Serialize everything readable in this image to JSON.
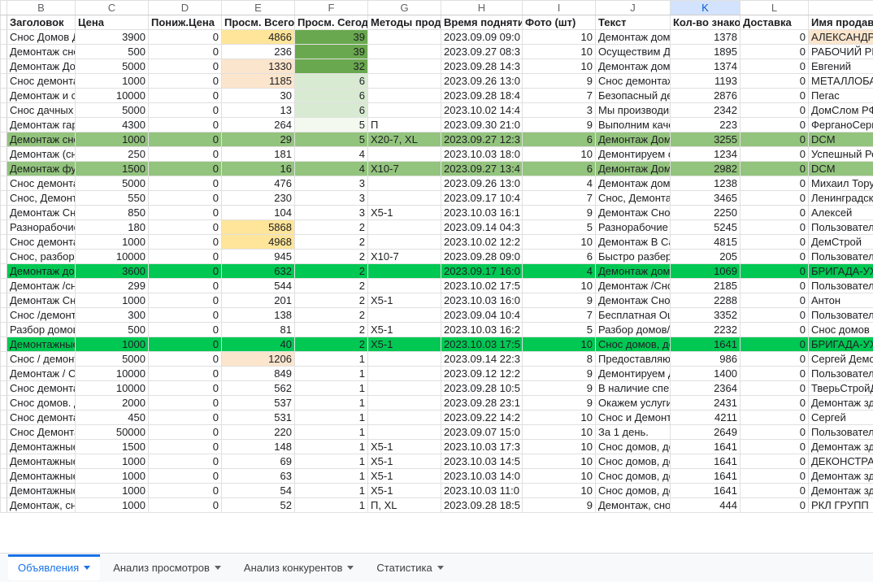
{
  "columns": [
    "",
    "B",
    "C",
    "D",
    "E",
    "F",
    "G",
    "H",
    "I",
    "J",
    "K",
    "L",
    ""
  ],
  "selectedCol": 10,
  "headers": {
    "B": "Заголовок",
    "C": "Цена",
    "D": "Пониж.Цена",
    "E": "Просм. Всего",
    "F": "Просм. Сегодня",
    "G": "Методы продв",
    "H": "Время поднятия",
    "I": "Фото (шт)",
    "J": "Текст",
    "K": "Кол-во знаков",
    "L": "Доставка",
    "M": "Имя продав"
  },
  "rows": [
    {
      "B": "Снос Домов Де",
      "C": "3900",
      "D": "0",
      "E": "4866",
      "F": "39",
      "G": "",
      "H": "2023.09.09 09:0",
      "I": "10",
      "J": "Демонтаж домо",
      "K": "1378",
      "L": "0",
      "M": "АЛЕКСАНДР",
      "cls": {
        "E": "hl-yellow",
        "F": "hl-bright",
        "M": "hl-peach"
      }
    },
    {
      "B": "Демонтаж снос",
      "C": "500",
      "D": "0",
      "E": "236",
      "F": "39",
      "G": "",
      "H": "2023.09.27 08:3",
      "I": "10",
      "J": "Осуществим Де",
      "K": "1895",
      "L": "0",
      "M": "РАБОЧИЙ РЕ",
      "cls": {
        "F": "hl-bright"
      }
    },
    {
      "B": "Демонтаж Домо",
      "C": "5000",
      "D": "0",
      "E": "1330",
      "F": "32",
      "G": "",
      "H": "2023.09.28 14:3",
      "I": "10",
      "J": "Демонтаж домо",
      "K": "1374",
      "L": "0",
      "M": "Евгений",
      "cls": {
        "E": "hl-peach",
        "F": "hl-bright"
      }
    },
    {
      "B": "Снос демонтаж",
      "C": "1000",
      "D": "0",
      "E": "1185",
      "F": "6",
      "G": "",
      "H": "2023.09.26 13:0",
      "I": "9",
      "J": "Снос демонтаж",
      "K": "1193",
      "L": "0",
      "M": "МЕТАЛЛОБА",
      "cls": {
        "E": "hl-peach",
        "F": "hl-pale2"
      }
    },
    {
      "B": "Демонтаж и сно",
      "C": "10000",
      "D": "0",
      "E": "30",
      "F": "6",
      "G": "",
      "H": "2023.09.28 18:4",
      "I": "7",
      "J": "Безопасный де",
      "K": "2876",
      "L": "0",
      "M": "Пегас",
      "cls": {
        "F": "hl-pale2"
      }
    },
    {
      "B": "Снос дачных до",
      "C": "5000",
      "D": "0",
      "E": "13",
      "F": "6",
      "G": "",
      "H": "2023.10.02 14:4",
      "I": "3",
      "J": "Мы производим",
      "K": "2342",
      "L": "0",
      "M": "ДомСлом РФ",
      "cls": {
        "F": "hl-pale2"
      }
    },
    {
      "B": "Демонтаж гара",
      "C": "4300",
      "D": "0",
      "E": "264",
      "F": "5",
      "G": "П",
      "H": "2023.09.30 21:0",
      "I": "9",
      "J": "Выполним каче",
      "K": "223",
      "L": "0",
      "M": "ФерганоСерв",
      "cls": {
        "F": "hl-pale"
      }
    },
    {
      "B": "Демонтаж снос",
      "C": "1000",
      "D": "0",
      "E": "29",
      "F": "5",
      "G": "X20-7, XL",
      "H": "2023.09.27 12:3",
      "I": "6",
      "J": "Демонтаж Домо",
      "K": "3255",
      "L": "0",
      "M": "DCM",
      "cls": {
        "row": "hl-green"
      }
    },
    {
      "B": "Демонтаж (снос",
      "C": "250",
      "D": "0",
      "E": "181",
      "F": "4",
      "G": "",
      "H": "2023.10.03 18:0",
      "I": "10",
      "J": "Демонтируем с",
      "K": "1234",
      "L": "0",
      "M": "Успешный Ре",
      "cls": {}
    },
    {
      "B": "Демонтаж фунд",
      "C": "1500",
      "D": "0",
      "E": "16",
      "F": "4",
      "G": "X10-7",
      "H": "2023.09.27 13:4",
      "I": "6",
      "J": "Демонтаж Домо",
      "K": "2982",
      "L": "0",
      "M": "DCM",
      "cls": {
        "row": "hl-green"
      }
    },
    {
      "B": "Снос демонтаж",
      "C": "5000",
      "D": "0",
      "E": "476",
      "F": "3",
      "G": "",
      "H": "2023.09.26 13:0",
      "I": "4",
      "J": "Демонтаж домо",
      "K": "1238",
      "L": "0",
      "M": "Михаил Торут",
      "cls": {}
    },
    {
      "B": "Снос, Демонтаж",
      "C": "550",
      "D": "0",
      "E": "230",
      "F": "3",
      "G": "",
      "H": "2023.09.17 10:4",
      "I": "7",
      "J": "Снос, Демонтаж",
      "K": "3465",
      "L": "0",
      "M": "Ленинградск",
      "cls": {}
    },
    {
      "B": "Демонтаж Снос",
      "C": "850",
      "D": "0",
      "E": "104",
      "F": "3",
      "G": "X5-1",
      "H": "2023.10.03 16:1",
      "I": "9",
      "J": "Демонтаж Снос",
      "K": "2250",
      "L": "0",
      "M": "Алексей",
      "cls": {}
    },
    {
      "B": "Разнорабочие,",
      "C": "180",
      "D": "0",
      "E": "5868",
      "F": "2",
      "G": "",
      "H": "2023.09.14 04:3",
      "I": "5",
      "J": "Разнорабочие г",
      "K": "5245",
      "L": "0",
      "M": "Пользователь",
      "cls": {
        "E": "hl-yellow"
      }
    },
    {
      "B": "Снос демонтаж",
      "C": "1000",
      "D": "0",
      "E": "4968",
      "F": "2",
      "G": "",
      "H": "2023.10.02 12:2",
      "I": "10",
      "J": "Демонтаж В Са",
      "K": "4815",
      "L": "0",
      "M": "ДемСтрой",
      "cls": {
        "E": "hl-yellow"
      }
    },
    {
      "B": "Снос, разбор по",
      "C": "10000",
      "D": "0",
      "E": "945",
      "F": "2",
      "G": "X10-7",
      "H": "2023.09.28 09:0",
      "I": "6",
      "J": "Быстро разбере",
      "K": "205",
      "L": "0",
      "M": "Пользователь",
      "cls": {}
    },
    {
      "B": "Демонтаж домо",
      "C": "3600",
      "D": "0",
      "E": "632",
      "F": "2",
      "G": "",
      "H": "2023.09.17 16:0",
      "I": "4",
      "J": "Демонтаж домо",
      "K": "1069",
      "L": "0",
      "M": "БРИГАДА-УХ",
      "cls": {
        "row": "hl-lime"
      }
    },
    {
      "B": "Демонтаж /снос",
      "C": "299",
      "D": "0",
      "E": "544",
      "F": "2",
      "G": "",
      "H": "2023.10.02 17:5",
      "I": "10",
      "J": "Демонтаж /Сно",
      "K": "2185",
      "L": "0",
      "M": "Пользователь",
      "cls": {}
    },
    {
      "B": "Демонтаж Снос",
      "C": "1000",
      "D": "0",
      "E": "201",
      "F": "2",
      "G": "X5-1",
      "H": "2023.10.03 16:0",
      "I": "9",
      "J": "Демонтаж Снос",
      "K": "2288",
      "L": "0",
      "M": "Антон",
      "cls": {}
    },
    {
      "B": "Снос /демонтаж",
      "C": "300",
      "D": "0",
      "E": "138",
      "F": "2",
      "G": "",
      "H": "2023.09.04 10:4",
      "I": "7",
      "J": "Бесплатная Оц",
      "K": "3352",
      "L": "0",
      "M": "Пользователь",
      "cls": {}
    },
    {
      "B": "Разбор домов/С",
      "C": "500",
      "D": "0",
      "E": "81",
      "F": "2",
      "G": "X5-1",
      "H": "2023.10.03 16:2",
      "I": "5",
      "J": "Разбор домов/",
      "K": "2232",
      "L": "0",
      "M": "Снос домов з",
      "cls": {}
    },
    {
      "B": "Демонтажные р",
      "C": "1000",
      "D": "0",
      "E": "40",
      "F": "2",
      "G": "X5-1",
      "H": "2023.10.03 17:5",
      "I": "10",
      "J": "Снос домов, де",
      "K": "1641",
      "L": "0",
      "M": "БРИГАДА-УХ",
      "cls": {
        "row": "hl-lime"
      }
    },
    {
      "B": "Снос / демонта",
      "C": "5000",
      "D": "0",
      "E": "1206",
      "F": "1",
      "G": "",
      "H": "2023.09.14 22:3",
      "I": "8",
      "J": "Предоставляю",
      "K": "986",
      "L": "0",
      "M": "Сергей Демо",
      "cls": {
        "E": "hl-peach"
      }
    },
    {
      "B": "Демонтаж / Сно",
      "C": "10000",
      "D": "0",
      "E": "849",
      "F": "1",
      "G": "",
      "H": "2023.09.12 12:2",
      "I": "9",
      "J": "Демонтируем д",
      "K": "1400",
      "L": "0",
      "M": "Пользователь",
      "cls": {}
    },
    {
      "B": "Снос демонтаж",
      "C": "10000",
      "D": "0",
      "E": "562",
      "F": "1",
      "G": "",
      "H": "2023.09.28 10:5",
      "I": "9",
      "J": "В наличие спец",
      "K": "2364",
      "L": "0",
      "M": "ТверьСтройД",
      "cls": {}
    },
    {
      "B": "Снос домов. Де",
      "C": "2000",
      "D": "0",
      "E": "537",
      "F": "1",
      "G": "",
      "H": "2023.09.28 23:1",
      "I": "9",
      "J": "Окажем услуги",
      "K": "2431",
      "L": "0",
      "M": "Демонтаж зда",
      "cls": {}
    },
    {
      "B": "Снос демонтаж",
      "C": "450",
      "D": "0",
      "E": "531",
      "F": "1",
      "G": "",
      "H": "2023.09.22 14:2",
      "I": "10",
      "J": "Снос и Демонта",
      "K": "4211",
      "L": "0",
      "M": "Сергей",
      "cls": {}
    },
    {
      "B": "Снос Демонтаж",
      "C": "50000",
      "D": "0",
      "E": "220",
      "F": "1",
      "G": "",
      "H": "2023.09.07 15:0",
      "I": "10",
      "J": "За 1 день.",
      "K": "2649",
      "L": "0",
      "M": "Пользователь",
      "cls": {}
    },
    {
      "B": "Демонтажные р",
      "C": "1500",
      "D": "0",
      "E": "148",
      "F": "1",
      "G": "X5-1",
      "H": "2023.10.03 17:3",
      "I": "10",
      "J": "Снос домов, де",
      "K": "1641",
      "L": "0",
      "M": "Демонтаж зда",
      "cls": {}
    },
    {
      "B": "Демонтажные р",
      "C": "1000",
      "D": "0",
      "E": "69",
      "F": "1",
      "G": "X5-1",
      "H": "2023.10.03 14:5",
      "I": "10",
      "J": "Снос домов, де",
      "K": "1641",
      "L": "0",
      "M": "ДЕКОНСТРАН",
      "cls": {}
    },
    {
      "B": "Демонтажные р",
      "C": "1000",
      "D": "0",
      "E": "63",
      "F": "1",
      "G": "X5-1",
      "H": "2023.10.03 14:0",
      "I": "10",
      "J": "Снос домов, де",
      "K": "1641",
      "L": "0",
      "M": "Демонтаж зда",
      "cls": {}
    },
    {
      "B": "Демонтажные р",
      "C": "1000",
      "D": "0",
      "E": "54",
      "F": "1",
      "G": "X5-1",
      "H": "2023.10.03 11:0",
      "I": "10",
      "J": "Снос домов, де",
      "K": "1641",
      "L": "0",
      "M": "Демонтаж зда",
      "cls": {}
    },
    {
      "B": "Демонтаж, снос",
      "C": "1000",
      "D": "0",
      "E": "52",
      "F": "1",
      "G": "П, XL",
      "H": "2023.09.28 18:5",
      "I": "9",
      "J": "Демонтаж, снос",
      "K": "444",
      "L": "0",
      "M": "РКЛ ГРУПП",
      "cls": {}
    }
  ],
  "numericCols": [
    "C",
    "D",
    "E",
    "F",
    "I",
    "K",
    "L"
  ],
  "tabs": [
    {
      "label": "Объявления",
      "active": true
    },
    {
      "label": "Анализ просмотров",
      "active": false
    },
    {
      "label": "Анализ конкурентов",
      "active": false
    },
    {
      "label": "Статистика",
      "active": false
    }
  ]
}
